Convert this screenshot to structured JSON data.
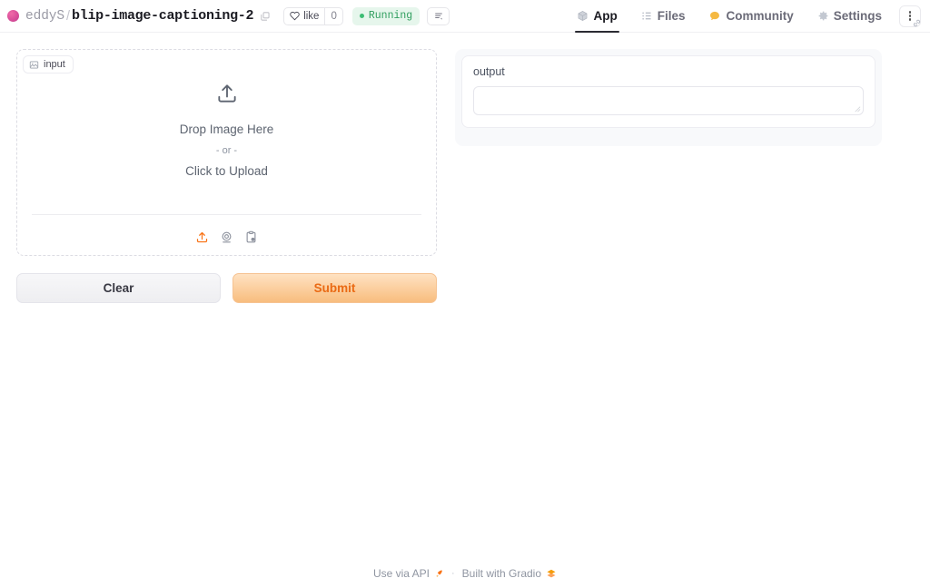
{
  "header": {
    "owner": "eddyS",
    "separator": "/",
    "space_name": "blip-image-captioning-2",
    "copy_icon": "copy-icon",
    "like_label": "like",
    "like_count": "0",
    "status_label": "Running",
    "status_color": "#2f9e5e",
    "status_bg": "#e6f6ec",
    "logs_icon": "logs-icon",
    "tabs": [
      {
        "label": "App",
        "icon": "cube-icon",
        "active": true
      },
      {
        "label": "Files",
        "icon": "files-icon",
        "active": false
      },
      {
        "label": "Community",
        "icon": "community-icon",
        "active": false
      },
      {
        "label": "Settings",
        "icon": "gear-icon",
        "active": false
      }
    ],
    "more_menu_icon": "vertical-dots-icon",
    "link_icon": "link-icon"
  },
  "input_panel": {
    "label": "input",
    "label_icon": "image-icon",
    "upload_icon": "upload-icon",
    "drop_text": "Drop Image Here",
    "or_text": "- or -",
    "click_text": "Click to Upload",
    "tools": [
      {
        "name": "upload-icon",
        "color": "#f97316"
      },
      {
        "name": "webcam-icon",
        "color": "#8b909c"
      },
      {
        "name": "clipboard-paste-icon",
        "color": "#8b909c"
      }
    ]
  },
  "actions": {
    "clear_label": "Clear",
    "submit_label": "Submit",
    "submit_color": "#ea6a14"
  },
  "output_panel": {
    "label": "output",
    "value": "",
    "placeholder": ""
  },
  "footer": {
    "api_label": "Use via API",
    "api_icon": "rocket-icon",
    "separator": "·",
    "built_label": "Built with Gradio",
    "gradio_icon": "gradio-logo-icon"
  }
}
